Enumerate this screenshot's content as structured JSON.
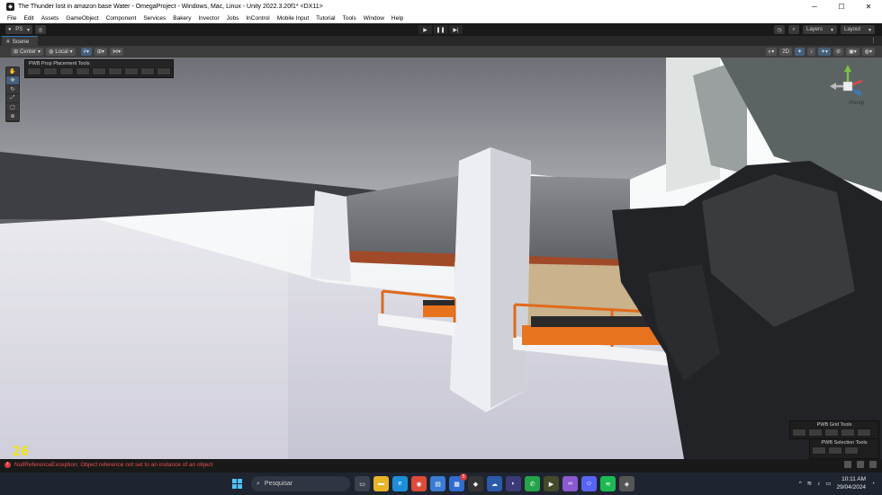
{
  "window": {
    "title": "The Thunder lost in amazon base Water - OmegaProject - Windows, Mac, Linux - Unity 2022.3.20f1* <DX11>",
    "minimize": "─",
    "maximize": "☐",
    "close": "✕"
  },
  "menu": [
    "File",
    "Edit",
    "Assets",
    "GameObject",
    "Component",
    "Services",
    "Bakery",
    "Invector",
    "Jobs",
    "InControl",
    "Mobile Input",
    "Tutorial",
    "Tools",
    "Window",
    "Help"
  ],
  "toolbar": {
    "account": "PS",
    "layers_label": "Layers",
    "layout_label": "Layout"
  },
  "scene": {
    "tab_label": "Scene",
    "pivot_label": "Center",
    "space_label": "Local",
    "mode_2d": "2D",
    "camera_mode": "Persp"
  },
  "pwb": {
    "prop_tools_title": "PWB Prop Placement Tools",
    "grid_tools_title": "PWB Grid Tools",
    "selection_tools_title": "PWB Selection Tools"
  },
  "fps_counter": "26",
  "status": {
    "message": "NullReferenceException: Object reference not set to an instance of an object"
  },
  "taskbar": {
    "search_placeholder": "Pesquisar",
    "time": "10:11 AM",
    "date": "29/04/2024",
    "notification_badge": "5"
  },
  "colors": {
    "error": "#e55050",
    "fps": "#f2e600",
    "accent": "#3a79bb",
    "orange_rail": "#e06a1a"
  }
}
